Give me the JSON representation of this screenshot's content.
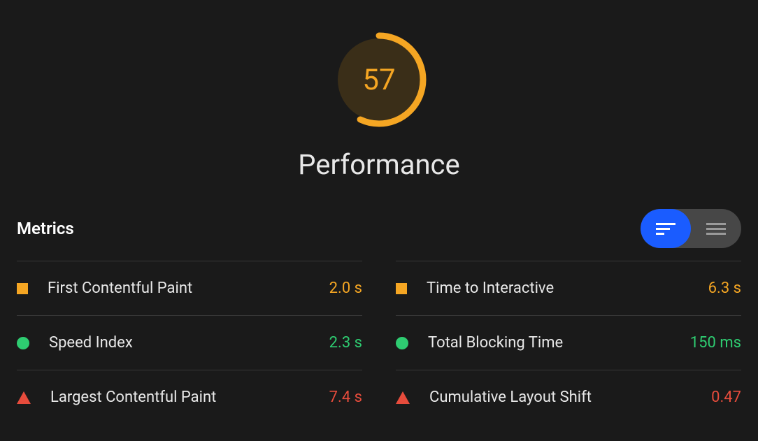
{
  "gauge": {
    "score": "57",
    "score_numeric": 57,
    "title": "Performance",
    "color": "#f5a623"
  },
  "metrics_section": {
    "title": "Metrics"
  },
  "metrics": {
    "left": [
      {
        "icon": "square",
        "label": "First Contentful Paint",
        "value": "2.0 s",
        "status": "orange"
      },
      {
        "icon": "circle",
        "label": "Speed Index",
        "value": "2.3 s",
        "status": "green"
      },
      {
        "icon": "triangle",
        "label": "Largest Contentful Paint",
        "value": "7.4 s",
        "status": "red"
      }
    ],
    "right": [
      {
        "icon": "square",
        "label": "Time to Interactive",
        "value": "6.3 s",
        "status": "orange"
      },
      {
        "icon": "circle",
        "label": "Total Blocking Time",
        "value": "150 ms",
        "status": "green"
      },
      {
        "icon": "triangle",
        "label": "Cumulative Layout Shift",
        "value": "0.47",
        "status": "red"
      }
    ]
  },
  "view_toggle": {
    "active": "detailed"
  }
}
